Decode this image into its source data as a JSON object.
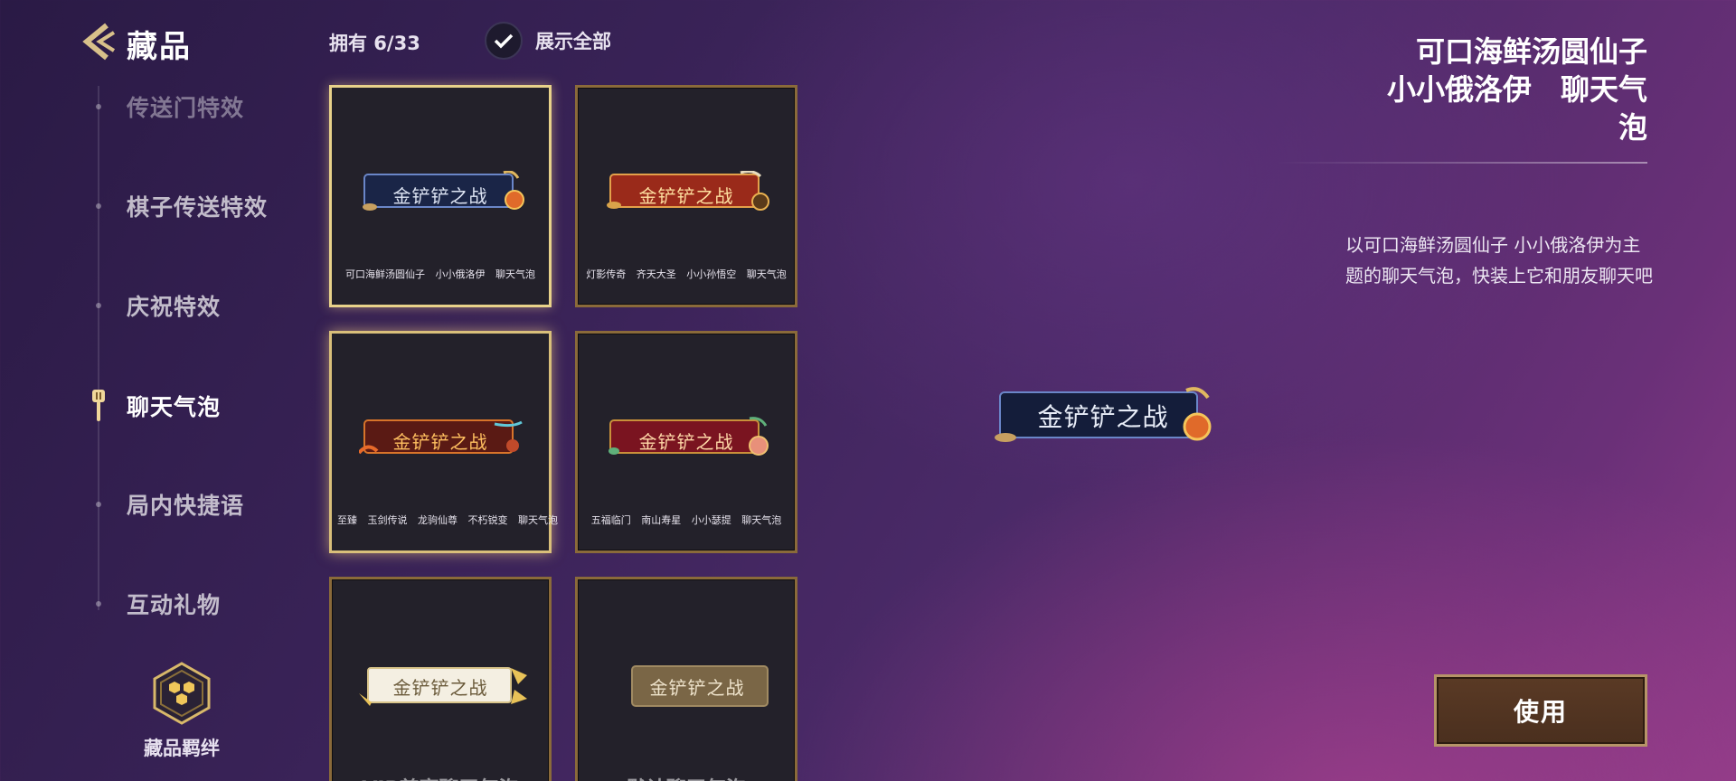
{
  "header": {
    "title": "藏品",
    "owned": "拥有 6/33",
    "show_all": "展示全部"
  },
  "nav": {
    "items": [
      {
        "label": "传送门特效"
      },
      {
        "label": "棋子传送特效"
      },
      {
        "label": "庆祝特效"
      },
      {
        "label": "聊天气泡"
      },
      {
        "label": "局内快捷语"
      },
      {
        "label": "互动礼物"
      }
    ],
    "bond_label": "藏品羁绊"
  },
  "bubble_text": "金铲铲之战",
  "cards": [
    {
      "caption": "可口海鲜汤圆仙子 小小俄洛伊 聊天气泡"
    },
    {
      "caption": "灯影传奇 齐天大圣 小小孙悟空 聊天气泡"
    },
    {
      "caption": "至臻 玉剑传说 龙驹仙尊 不朽锐变 聊天气泡"
    },
    {
      "caption": "五福临门 南山寿星 小小瑟提 聊天气泡"
    },
    {
      "caption": "VIP尊享聊天气泡"
    },
    {
      "caption": "默认聊天气泡"
    }
  ],
  "detail": {
    "title_line1": "可口海鲜汤圆仙子",
    "title_line2": "小小俄洛伊　聊天气",
    "title_line3": "泡",
    "description": "以可口海鲜汤圆仙子 小小俄洛伊为主题的聊天气泡，快装上它和朋友聊天吧"
  },
  "use_button": "使用",
  "colors": {
    "gold_border": "#8a6a3a",
    "selected_border": "#e8d28a",
    "card_bg": "#23212a"
  }
}
